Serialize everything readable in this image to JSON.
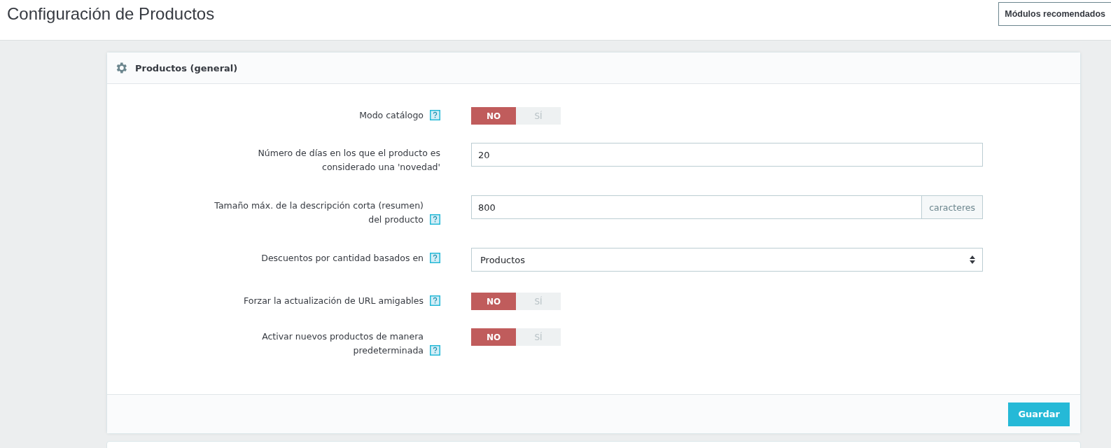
{
  "header": {
    "title": "Configuración de Productos",
    "button": "Módulos recomendados"
  },
  "panel": {
    "title": "Productos (general)",
    "fields": [
      {
        "kind": "toggle",
        "label": "Modo catálogo",
        "help": true,
        "options": [
          {
            "label": "NO",
            "selected": true
          },
          {
            "label": "SÍ",
            "selected": false
          }
        ]
      },
      {
        "kind": "text",
        "label": "Número de días en los que el producto es considerado una 'novedad'",
        "help": false,
        "value": "20"
      },
      {
        "kind": "text",
        "label": "Tamaño máx. de la descripción corta (resumen) del producto",
        "help": true,
        "value": "800",
        "addon": "caracteres"
      },
      {
        "kind": "select",
        "label": "Descuentos por cantidad basados en",
        "help": true,
        "value": "Productos"
      },
      {
        "kind": "toggle",
        "label": "Forzar la actualización de URL amigables",
        "help": true,
        "options": [
          {
            "label": "NO",
            "selected": true
          },
          {
            "label": "SÍ",
            "selected": false
          }
        ]
      },
      {
        "kind": "toggle",
        "label": "Activar nuevos productos de manera predeterminada",
        "help": true,
        "options": [
          {
            "label": "NO",
            "selected": true
          },
          {
            "label": "SÍ",
            "selected": false
          }
        ]
      }
    ],
    "save": "Guardar"
  }
}
